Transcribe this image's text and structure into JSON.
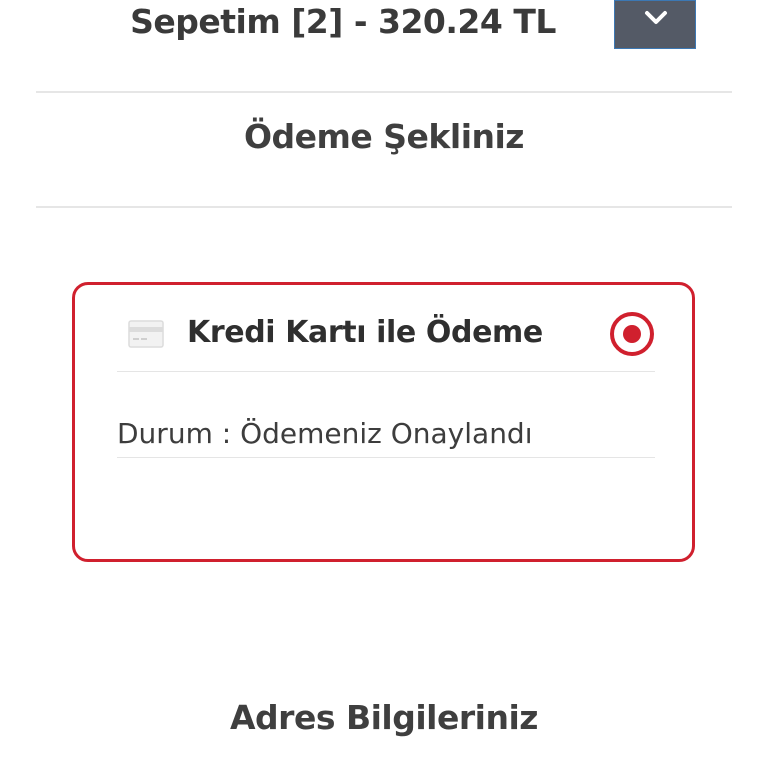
{
  "cart": {
    "title": "Sepetim [2] - 320.24 TL",
    "toggle_icon": "chevron-down-icon"
  },
  "payment_section": {
    "title": "Ödeme Şekliniz",
    "method": {
      "icon": "credit-card-icon",
      "label": "Kredi Kartı ile Ödeme",
      "selected": true,
      "status": "Durum : Ödemeniz Onaylandı"
    }
  },
  "address_section": {
    "title": "Adres Bilgileriniz"
  },
  "colors": {
    "accent": "#d0202e",
    "toggle_bg": "#545a66",
    "text": "#3f3f3f",
    "divider": "#e6e6e6"
  }
}
